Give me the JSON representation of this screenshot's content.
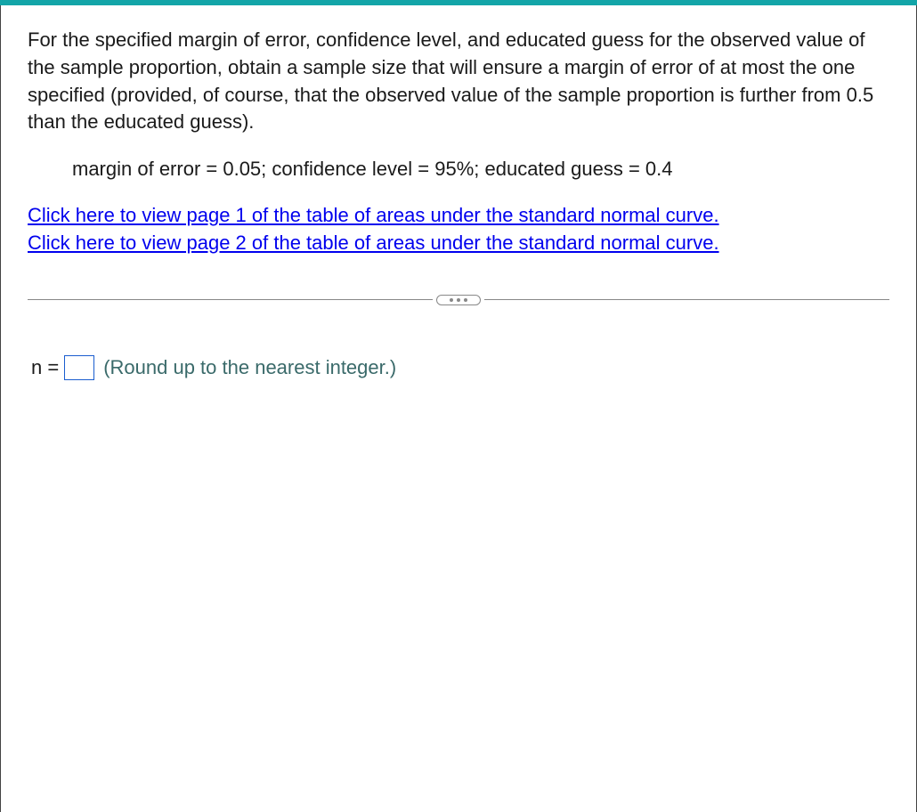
{
  "problem": {
    "statement": "For the specified margin of error, confidence level, and educated guess for the observed value of the sample proportion, obtain a sample size that will ensure a margin of error of at most the one specified (provided, of course, that the observed value of the sample proportion is further from 0.5 than the educated guess).",
    "given": "margin of error = 0.05; confidence level = 95%; educated guess = 0.4"
  },
  "links": {
    "table_page_1": "Click here to view page 1 of the table of areas under the standard normal curve.",
    "table_page_2": "Click here to view page 2 of the table of areas under the standard normal curve."
  },
  "answer": {
    "label_prefix": "n =",
    "hint": "(Round up to the nearest integer.)",
    "value": ""
  }
}
